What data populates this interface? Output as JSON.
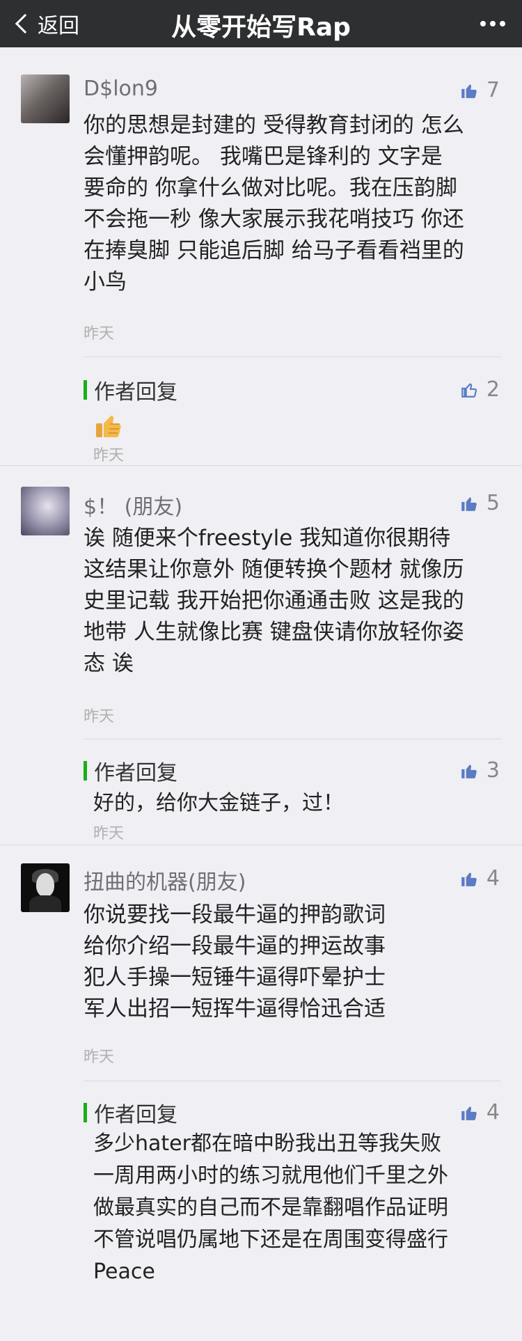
{
  "header": {
    "back_label": "返回",
    "title": "从零开始写Rap"
  },
  "comments": [
    {
      "name": "D$lon9",
      "likes": "7",
      "lines": [
        "你的思想是封建的 受得教育封闭的 怎么",
        "会懂押韵呢。 我嘴巴是锋利的  文字是",
        "要命的 你拿什么做对比呢。我在压韵脚",
        "不会拖一秒 像大家展示我花哨技巧 你还",
        "在捧臭脚 只能追后脚 给马子看看裆里的",
        "小鸟"
      ],
      "time": "昨天",
      "reply": {
        "label": "作者回复",
        "likes": "2",
        "lines": [],
        "time": "昨天"
      }
    },
    {
      "name": "$！ (朋友)",
      "likes": "5",
      "lines": [
        "诶 随便来个freestyle 我知道你很期待",
        "这结果让你意外 随便转换个题材 就像历",
        "史里记载 我开始把你通通击败 这是我的",
        "地带 人生就像比赛 键盘侠请你放轻你姿",
        "态 诶"
      ],
      "time": "昨天",
      "reply": {
        "label": "作者回复",
        "likes": "3",
        "lines": [
          "好的，给你大金链子，过！"
        ],
        "time": "昨天"
      }
    },
    {
      "name": "扭曲的机器(朋友)",
      "likes": "4",
      "lines": [
        "你说要找一段最牛逼的押韵歌词",
        "给你介绍一段最牛逼的押运故事",
        "犯人手操一短锤牛逼得吓晕护士",
        "军人出招一短挥牛逼得恰迅合适"
      ],
      "time": "昨天",
      "reply": {
        "label": "作者回复",
        "likes": "4",
        "lines": [
          "多少hater都在暗中盼我出丑等我失败",
          "一周用两小时的练习就甩他们千里之外",
          "做最真实的自己而不是靠翻唱作品证明",
          "不管说唱仍属地下还是在周围变得盛行",
          "Peace"
        ],
        "time": ""
      }
    }
  ],
  "colors": {
    "topbar": "#2e2f31",
    "background": "#efeff4",
    "reply_accent": "#1aad19",
    "like_icon": "#5b7cc4"
  }
}
